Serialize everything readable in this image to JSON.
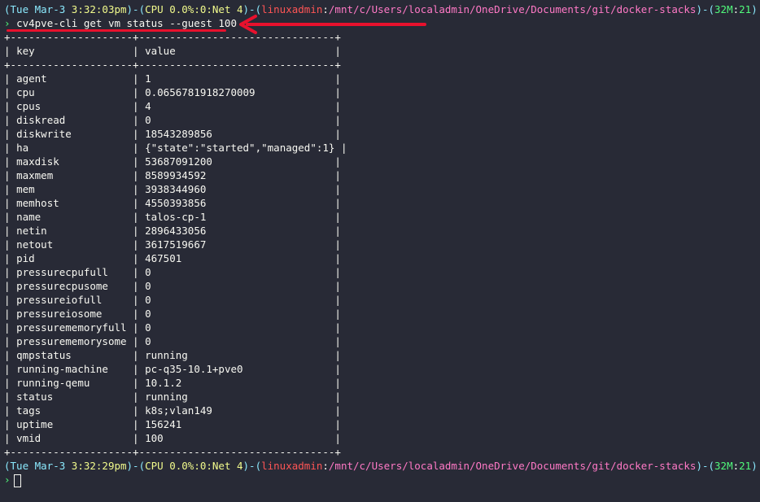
{
  "prompt1": {
    "open": "(",
    "day": "Tue Mar-3",
    "time": "3:32:03pm",
    "sep1": ")-(",
    "cpu": "CPU 0.0%:0:Net 4",
    "sep2": ")-(",
    "user": "linuxadmin",
    "colon": ":",
    "path": "/mnt/c/Users/localadmin/OneDrive/Documents/git/docker-stacks",
    "sep3": ")-(",
    "mem": "32M",
    "mcolon": ":",
    "count": "21",
    "close": ")"
  },
  "command": "cv4pve-cli get vm status --guest 100",
  "table": {
    "border": "+--------------------+--------------------------------+",
    "header_key": "key",
    "header_value": "value",
    "rows": [
      {
        "key": "agent",
        "value": "1"
      },
      {
        "key": "cpu",
        "value": "0.0656781918270009"
      },
      {
        "key": "cpus",
        "value": "4"
      },
      {
        "key": "diskread",
        "value": "0"
      },
      {
        "key": "diskwrite",
        "value": "18543289856"
      },
      {
        "key": "ha",
        "value": "{\"state\":\"started\",\"managed\":1}"
      },
      {
        "key": "maxdisk",
        "value": "53687091200"
      },
      {
        "key": "maxmem",
        "value": "8589934592"
      },
      {
        "key": "mem",
        "value": "3938344960"
      },
      {
        "key": "memhost",
        "value": "4550393856"
      },
      {
        "key": "name",
        "value": "talos-cp-1"
      },
      {
        "key": "netin",
        "value": "2896433056"
      },
      {
        "key": "netout",
        "value": "3617519667"
      },
      {
        "key": "pid",
        "value": "467501"
      },
      {
        "key": "pressurecpufull",
        "value": "0"
      },
      {
        "key": "pressurecpusome",
        "value": "0"
      },
      {
        "key": "pressureiofull",
        "value": "0"
      },
      {
        "key": "pressureiosome",
        "value": "0"
      },
      {
        "key": "pressurememoryfull",
        "value": "0"
      },
      {
        "key": "pressurememorysome",
        "value": "0"
      },
      {
        "key": "qmpstatus",
        "value": "running"
      },
      {
        "key": "running-machine",
        "value": "pc-q35-10.1+pve0"
      },
      {
        "key": "running-qemu",
        "value": "10.1.2"
      },
      {
        "key": "status",
        "value": "running"
      },
      {
        "key": "tags",
        "value": "k8s;vlan149"
      },
      {
        "key": "uptime",
        "value": "156241"
      },
      {
        "key": "vmid",
        "value": "100"
      }
    ]
  },
  "prompt2": {
    "open": "(",
    "day": "Tue Mar-3",
    "time": "3:32:29pm",
    "sep1": ")-(",
    "cpu": "CPU 0.0%:0:Net 4",
    "sep2": ")-(",
    "user": "linuxadmin",
    "colon": ":",
    "path": "/mnt/c/Users/localadmin/OneDrive/Documents/git/docker-stacks",
    "sep3": ")-(",
    "mem": "32M",
    "mcolon": ":",
    "count": "21",
    "close": ")"
  },
  "input_prompt_symbol": "›",
  "colors": {
    "background": "#282a36",
    "annotation_red": "#e8112d"
  },
  "icons": {
    "annotation": "arrow-left-icon"
  }
}
